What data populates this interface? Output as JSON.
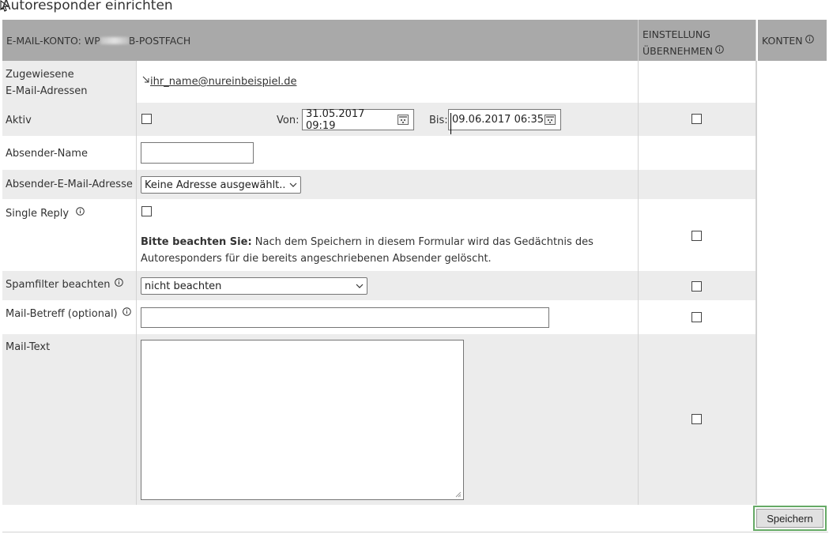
{
  "page": {
    "title": "Autoresponder einrichten"
  },
  "header": {
    "account_prefix": "E-MAIL-KONTO: WP",
    "account_suffix": "B-POSTFACH",
    "apply_line1": "EINSTELLUNG",
    "apply_line2": "ÜBERNEHMEN",
    "accounts": "KONTEN"
  },
  "rows": {
    "assigned": {
      "label_line1": "Zugewiesene",
      "label_line2": "E-Mail-Adressen",
      "address": "ihr_name@nureinbeispiel.de"
    },
    "active": {
      "label": "Aktiv",
      "from_label": "Von:",
      "from_value": "31.05.2017 09:19",
      "to_label": "Bis:",
      "to_value": "09.06.2017 06:35"
    },
    "sender_name": {
      "label": "Absender-Name",
      "value": ""
    },
    "sender_email": {
      "label": "Absender-E-Mail-Adresse",
      "selected": "Keine Adresse ausgewählt..."
    },
    "single_reply": {
      "label": "Single Reply",
      "note_bold": "Bitte beachten Sie:",
      "note_line1": " Nach dem Speichern in diesem Formular wird das Gedächtnis des",
      "note_line2": "Autoresponders für die bereits angeschriebenen Absender gelöscht."
    },
    "spamfilter": {
      "label": "Spamfilter beachten",
      "selected": "nicht beachten"
    },
    "subject": {
      "label": "Mail-Betreff (optional)",
      "value": ""
    },
    "mail_text": {
      "label": "Mail-Text"
    }
  },
  "actions": {
    "save": "Speichern"
  },
  "colors": {
    "header_bg": "#a9a9a9",
    "row_alt_bg": "#ececec",
    "save_focus": "#66aa66"
  }
}
